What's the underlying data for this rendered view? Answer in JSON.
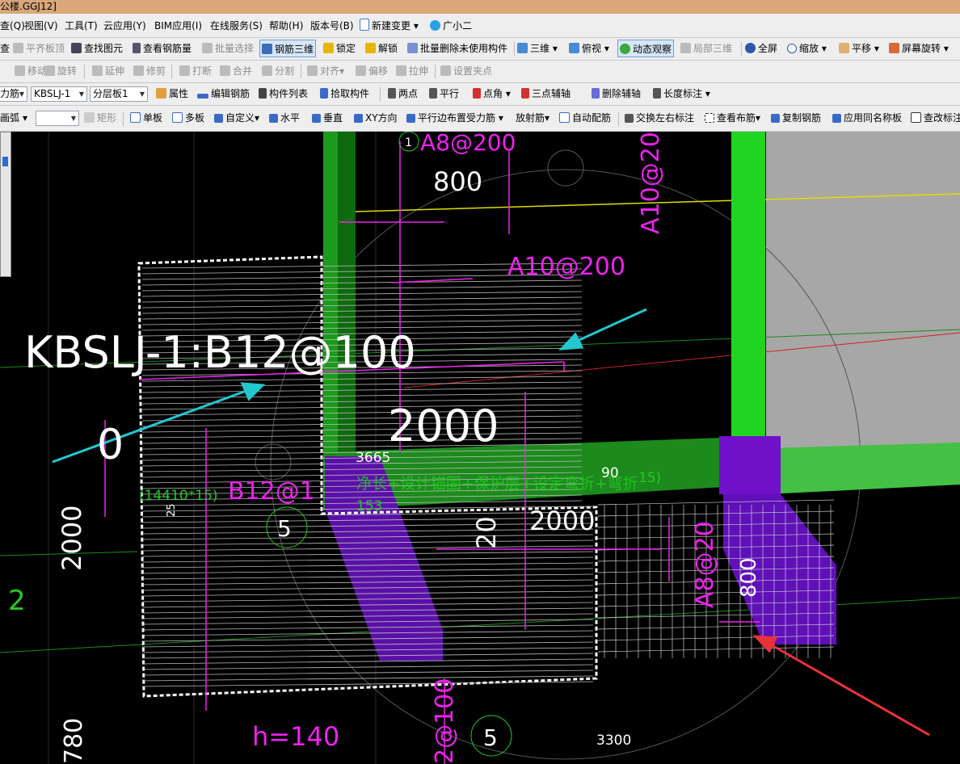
{
  "window": {
    "title": "公楼.GGJ12]"
  },
  "menu": [
    "查(Q)",
    "视图(V)",
    "工具(T)",
    "云应用(Y)",
    "BIM应用(I)",
    "在线服务(S)",
    "帮助(H)",
    "版本号(B)",
    "新建变更",
    "广小二"
  ],
  "toolbar1": [
    "查",
    "平齐板顶",
    "查找图元",
    "查看钢筋量",
    "批量选择",
    "钢筋三维",
    "锁定",
    "解锁",
    "批量删除未使用构件",
    "三维",
    "俯视",
    "动态观察",
    "局部三维",
    "全屏",
    "缩放",
    "平移",
    "屏幕旋转"
  ],
  "toolbar2": [
    "移动",
    "旋转",
    "延伸",
    "修剪",
    "打断",
    "合并",
    "分割",
    "对齐",
    "偏移",
    "拉伸",
    "设置夹点"
  ],
  "toolbar3": {
    "type_select": "力筋",
    "component_select": "KBSLJ-1",
    "layer_select": "分层板1",
    "items": [
      "属性",
      "编辑钢筋",
      "构件列表",
      "拾取构件",
      "两点",
      "平行",
      "点角",
      "三点辅轴",
      "删除辅轴",
      "长度标注"
    ]
  },
  "toolbar4": {
    "mode_label": "画弧",
    "blank_select": "",
    "items": [
      "矩形",
      "单板",
      "多板",
      "自定义",
      "水平",
      "垂直",
      "XY方向",
      "平行边布置受力筋",
      "放射筋",
      "自动配筋",
      "交换左右标注",
      "查看布筋",
      "复制钢筋",
      "应用同名称板",
      "查改标注"
    ]
  },
  "colors": {
    "magenta": "#ee22ee",
    "green": "#22cc22",
    "cyan_arrow": "#22c8d0",
    "red_arrow": "#e8323a",
    "purple": "#7010c8",
    "gray": "#a7a7a7",
    "white": "#ffffff",
    "yellow": "#e8e800"
  },
  "annotations": {
    "main_label": "KBSLJ-1:B12@100",
    "a8_top": "A8@200",
    "dim_800_top": "800",
    "a10_vertical": "A10@20",
    "a10_horizontal": "A10@200",
    "dim_2000_center": "2000",
    "zero": "0",
    "dim_3665": "3665",
    "b12_label": "B12@1",
    "green_small": "(14410*15)",
    "small_25": "25",
    "net_length_text": "净长+设计锚固+保护层+设定弯折+弯折",
    "green_153": "153",
    "dim_90": "90",
    "green_15": "15)",
    "axis_5_left": "5",
    "axis_1_top": "1",
    "dim_2000_vertical": "2000",
    "green_2": "2",
    "dim_2000_second": "2000",
    "dim_20_vertical": "20",
    "a8_vertical": "A8@20",
    "dim_800_vertical": "800",
    "h_label": "h=140",
    "axis_5_bottom": "5",
    "dim_3300": "3300",
    "dim_780": "780",
    "bottom_100": "2@100"
  }
}
